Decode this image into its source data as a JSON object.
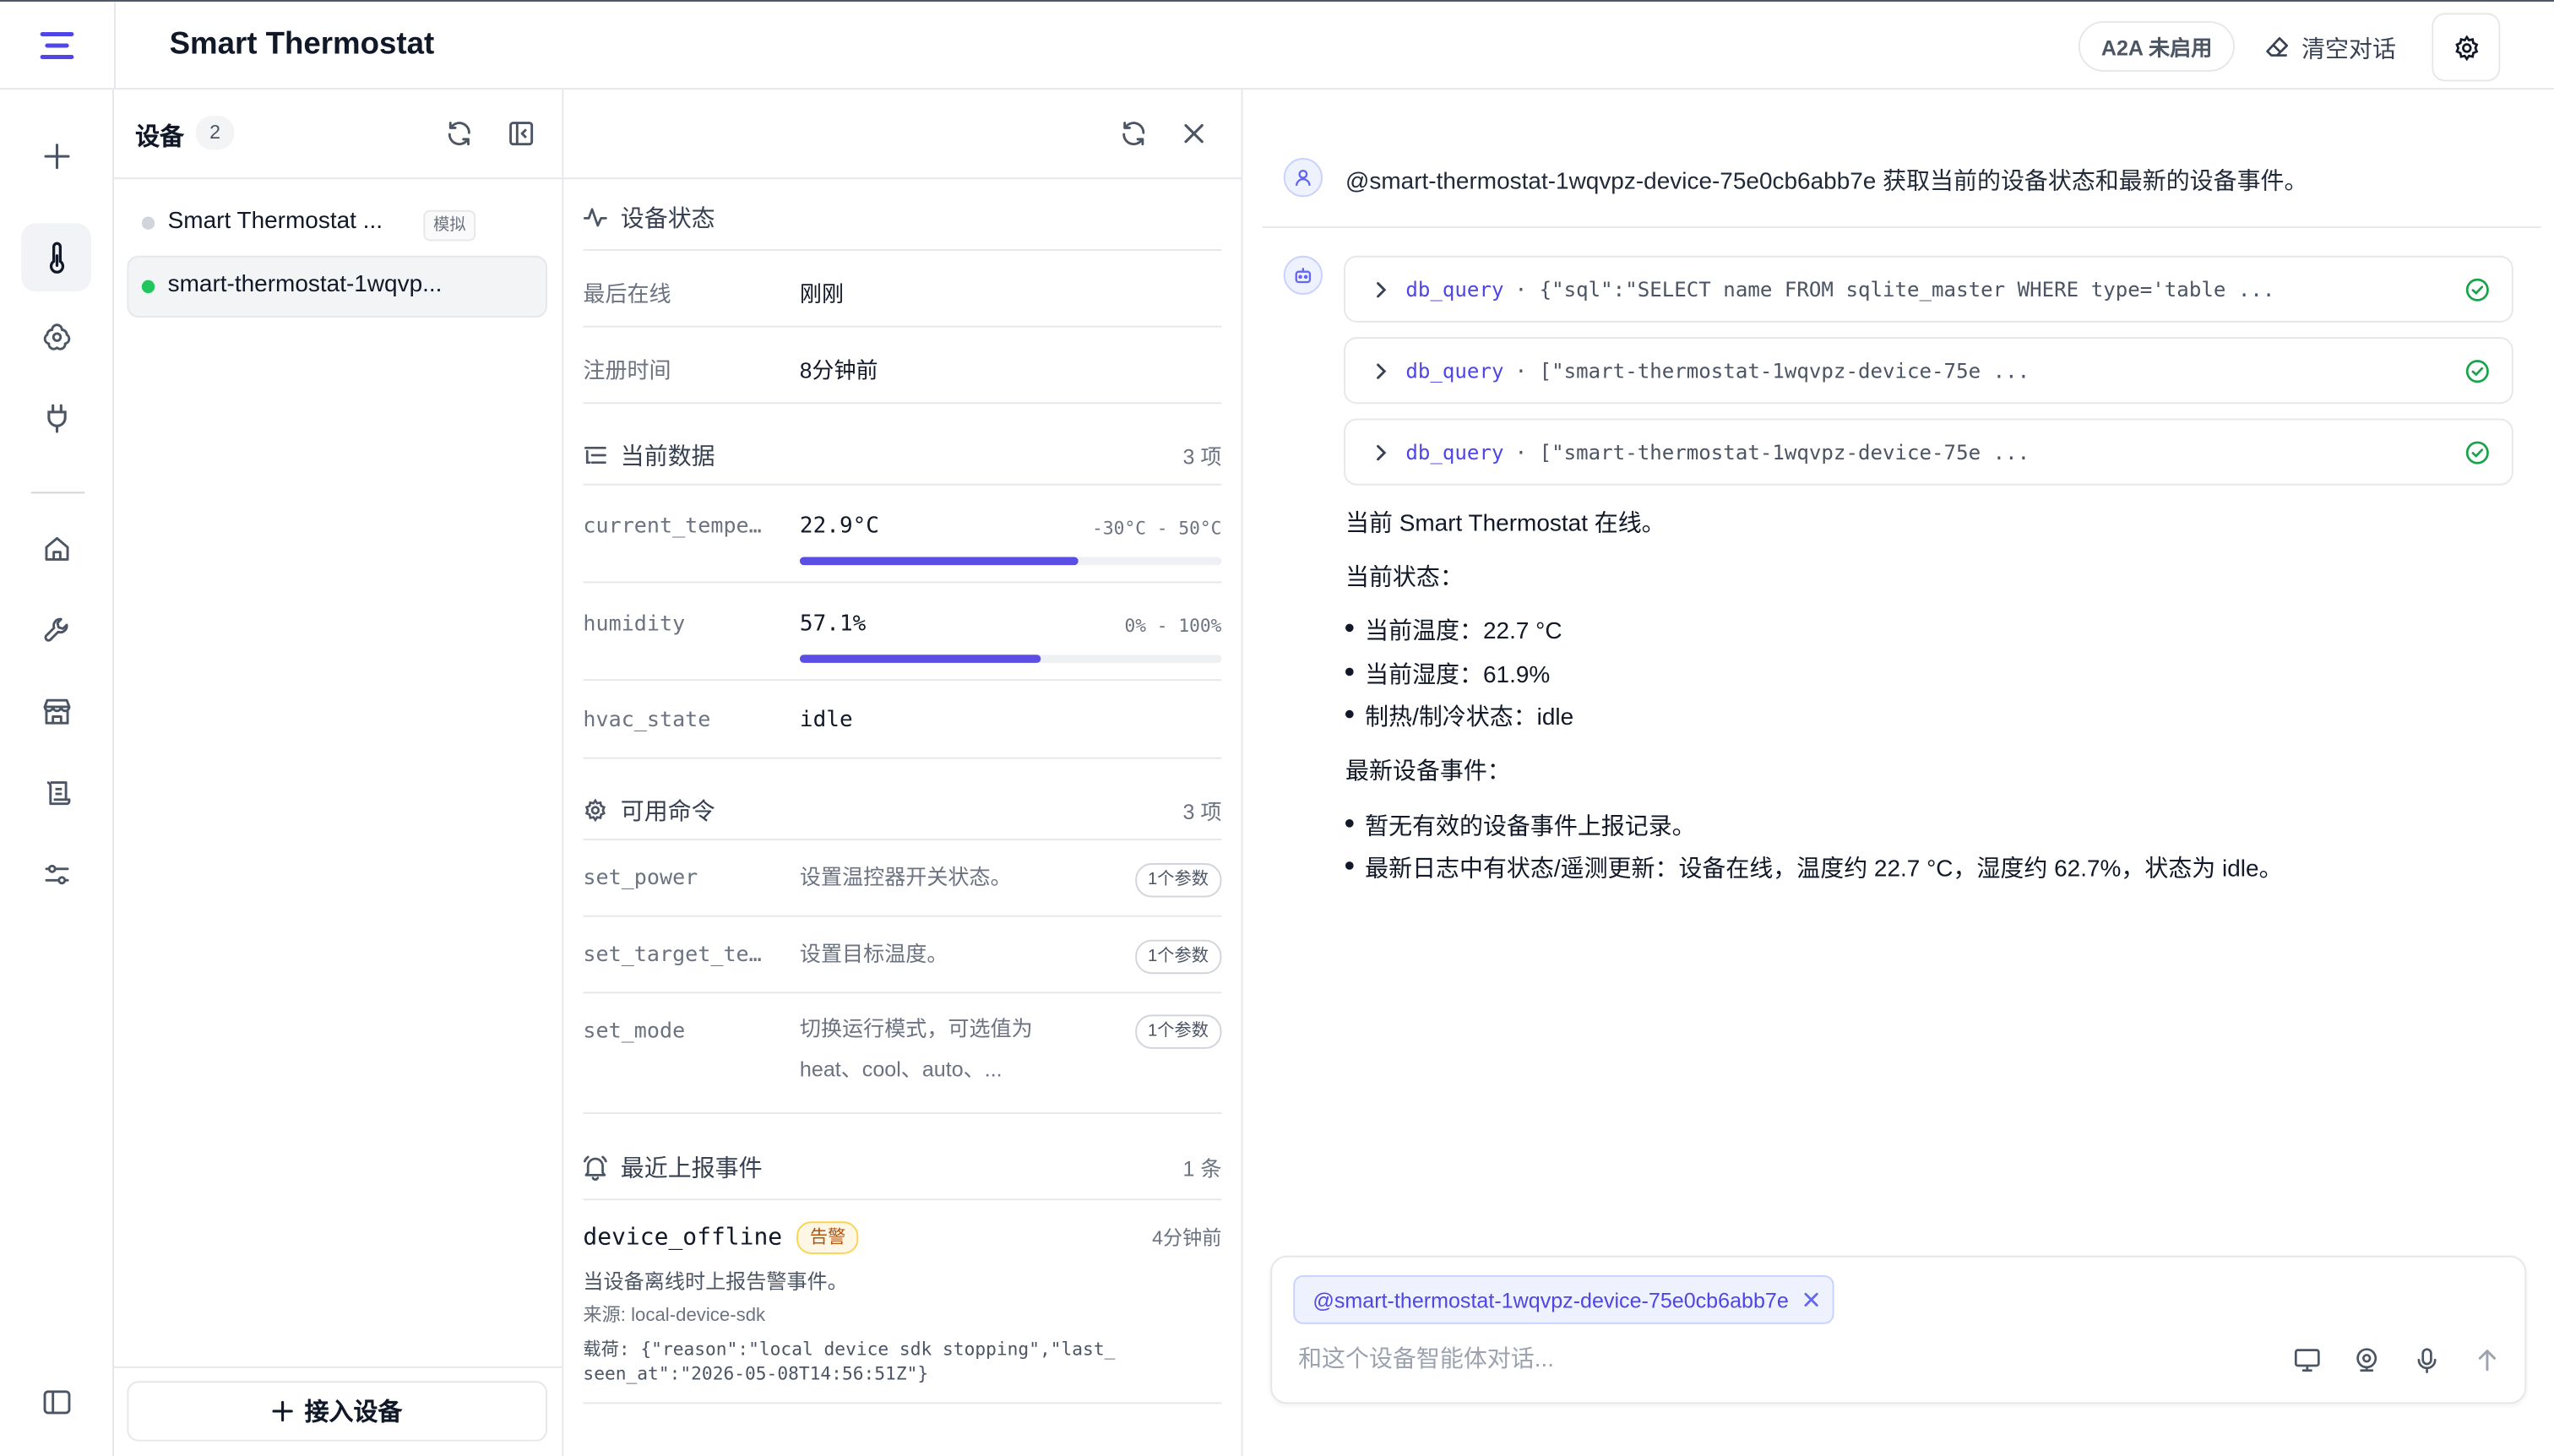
{
  "app": {
    "title": "Smart Thermostat"
  },
  "header": {
    "a2a_badge": "A2A 未启用",
    "clear_label": "清空对话"
  },
  "devices": {
    "title": "设备",
    "count": "2",
    "items": [
      {
        "name": "Smart Thermostat ...",
        "tag": "模拟",
        "status_color": "#d1d5db"
      },
      {
        "name": "smart-thermostat-1wqvp...",
        "status_color": "#22c55e"
      }
    ],
    "connect_label": "接入设备"
  },
  "status": {
    "title": "设备状态",
    "rows": [
      {
        "key": "最后在线",
        "value": "刚刚"
      },
      {
        "key": "注册时间",
        "value": "8分钟前"
      }
    ]
  },
  "data_section": {
    "title": "当前数据",
    "count": "3 项",
    "metrics": [
      {
        "key": "current_tempe…",
        "value": "22.9°C",
        "range": "-30°C - 50°C",
        "fraction": 0.66
      },
      {
        "key": "humidity",
        "value": "57.1%",
        "range": "0% - 100%",
        "fraction": 0.571
      },
      {
        "key": "hvac_state",
        "value": "idle"
      }
    ]
  },
  "commands": {
    "title": "可用命令",
    "count": "3 项",
    "items": [
      {
        "name": "set_power",
        "desc": "设置温控器开关状态。",
        "params": "1个参数"
      },
      {
        "name": "set_target_te…",
        "desc": "设置目标温度。",
        "params": "1个参数"
      },
      {
        "name": "set_mode",
        "desc": "切换运行模式，可选值为 heat、cool、auto、...",
        "params": "1个参数"
      }
    ]
  },
  "events": {
    "title": "最近上报事件",
    "count": "1 条",
    "items": [
      {
        "name": "device_offline",
        "level": "告警",
        "time": "4分钟前",
        "desc": "当设备离线时上报告警事件。",
        "source": "来源: local-device-sdk",
        "payload_line1": "载荷: {\"reason\":\"local device sdk stopping\",\"last_",
        "payload_line2": "seen_at\":\"2026-05-08T14:56:51Z\"}"
      }
    ]
  },
  "chat": {
    "user_message": "@smart-thermostat-1wqvpz-device-75e0cb6abb7e 获取当前的设备状态和最新的设备事件。",
    "tool_calls": [
      {
        "name": "db_query",
        "args": "· {\"sql\":\"SELECT name FROM sqlite_master WHERE type='table ..."
      },
      {
        "name": "db_query",
        "args": "· [\"smart-thermostat-1wqvpz-device-75e ..."
      },
      {
        "name": "db_query",
        "args": "· [\"smart-thermostat-1wqvpz-device-75e ..."
      }
    ],
    "reply": {
      "line1": "当前 Smart Thermostat 在线。",
      "status_title": "当前状态：",
      "status_items": [
        "当前温度：22.7 °C",
        "当前湿度：61.9%",
        "制热/制冷状态：idle"
      ],
      "events_title": "最新设备事件：",
      "event_items": [
        "暂无有效的设备事件上报记录。",
        "最新日志中有状态/遥测更新：设备在线，温度约 22.7 °C，湿度约 62.7%，状态为 idle。"
      ]
    },
    "mention": "@smart-thermostat-1wqvpz-device-75e0cb6abb7e",
    "input_placeholder": "和这个设备智能体对话...",
    "input_value": ""
  },
  "colors": {
    "accent": "#5b4ee5",
    "online": "#22c55e",
    "success": "#16a34a",
    "warn": "#b45309"
  }
}
